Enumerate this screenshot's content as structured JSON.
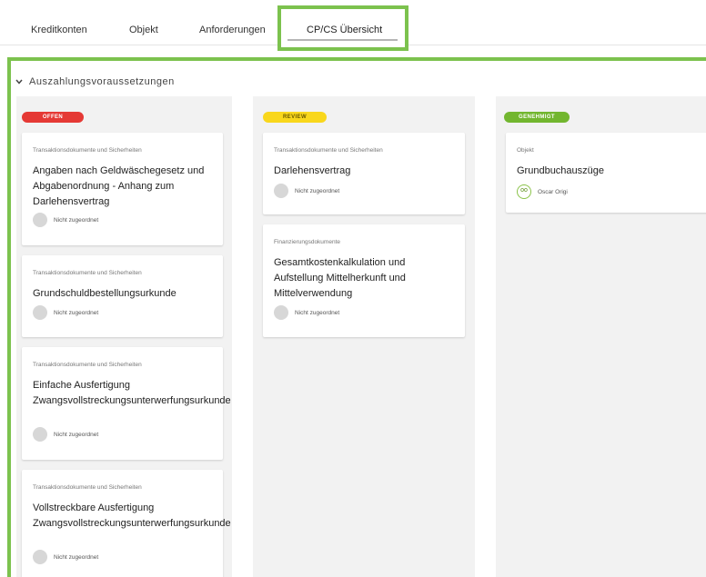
{
  "tabs": [
    {
      "label": "Kreditkonten"
    },
    {
      "label": "Objekt"
    },
    {
      "label": "Anforderungen"
    },
    {
      "label": "CP/CS Übersicht"
    }
  ],
  "section": {
    "title": "Auszahlungsvoraussetzungen"
  },
  "columns": [
    {
      "status": "OFFEN",
      "cards": [
        {
          "category": "Transaktionsdokumente und Sicherheiten",
          "title": "Angaben nach Geldwäschegesetz und Abgabenordnung - Anhang zum Darlehensvertrag",
          "assignee": "Nicht zugeordnet"
        },
        {
          "category": "Transaktionsdokumente und Sicherheiten",
          "title": "Grundschuldbestellungsurkunde",
          "assignee": "Nicht zugeordnet"
        },
        {
          "category": "Transaktionsdokumente und Sicherheiten",
          "title": "Einfache Ausfertigung Zwangsvollstreckungsunterwerfungsurkunde",
          "assignee": "Nicht zugeordnet"
        },
        {
          "category": "Transaktionsdokumente und Sicherheiten",
          "title": "Vollstreckbare Ausfertigung Zwangsvollstreckungsunterwerfungsurkunde",
          "assignee": "Nicht zugeordnet"
        }
      ]
    },
    {
      "status": "REVIEW",
      "cards": [
        {
          "category": "Transaktionsdokumente und Sicherheiten",
          "title": "Darlehensvertrag",
          "assignee": "Nicht zugeordnet"
        },
        {
          "category": "Finanzierungsdokumente",
          "title": "Gesamtkostenkalkulation und Aufstellung Mittelherkunft und Mittelverwendung",
          "assignee": "Nicht zugeordnet"
        }
      ]
    },
    {
      "status": "GENEHMIGT",
      "cards": [
        {
          "category": "Objekt",
          "title": "Grundbuchauszüge",
          "assignee": "Oscar Origi",
          "initials": "OO"
        }
      ]
    }
  ],
  "colors": {
    "highlight": "#7cc24e",
    "offen": "#e53935",
    "review": "#f9d71c",
    "genehmigt": "#72b62f"
  }
}
